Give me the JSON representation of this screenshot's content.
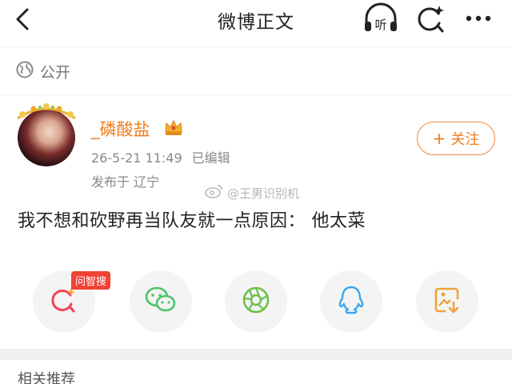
{
  "header": {
    "title": "微博正文"
  },
  "visibility": {
    "label": "公开"
  },
  "post": {
    "username": "_磷酸盐",
    "timestamp": "26-5-21 11:49",
    "edited_label": "已编辑",
    "location": "发布于 辽宁",
    "follow_label": "关注",
    "text": "我不想和砍野再当队友就一点原因： 他太菜"
  },
  "watermark": {
    "text": "@王男识别机"
  },
  "share": {
    "badge": "问智搜",
    "icons": [
      "ai-search-icon",
      "wechat-icon",
      "moments-icon",
      "qq-icon",
      "save-image-icon"
    ]
  },
  "related": {
    "title": "相关推荐"
  },
  "colors": {
    "accent": "#f07c1c",
    "wechat": "#4cc36a",
    "qq": "#3aa6f2",
    "badge": "#f04336"
  }
}
